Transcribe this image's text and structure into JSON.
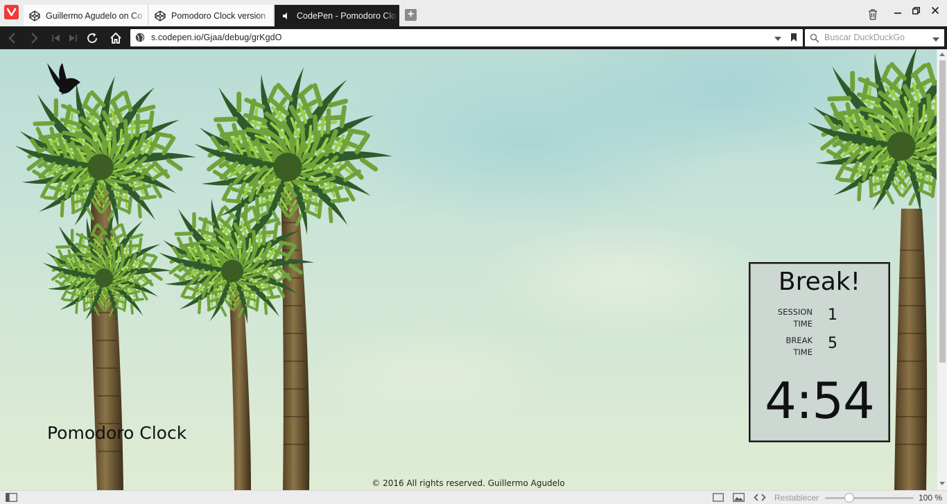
{
  "browser": {
    "tabs": [
      {
        "label": "Guillermo Agudelo on Co",
        "icon": "codepen-icon",
        "active": false
      },
      {
        "label": "Pomodoro Clock version",
        "icon": "codepen-icon",
        "active": false
      },
      {
        "label": "CodePen - Pomodoro Clo",
        "icon": "speaker-icon",
        "active": true
      }
    ],
    "address": "s.codepen.io/Gjaa/debug/grKgdO",
    "search_placeholder": "Buscar DuckDuckGo",
    "statusbar": {
      "reset_label": "Restablecer",
      "zoom": "100 %"
    }
  },
  "page": {
    "title": "Pomodoro Clock",
    "footer": "© 2016 All rights reserved. Guillermo Agudelo",
    "timer": {
      "status": "Break!",
      "session_label_1": "SESSION",
      "session_label_2": "TIME",
      "session_value": "1",
      "break_label_1": "BREAK",
      "break_label_2": "TIME",
      "break_value": "5",
      "countdown": "4:54"
    }
  },
  "colors": {
    "chrome_dark": "#1d1d1d",
    "vivaldi_red": "#ef3939",
    "sky": "#c6e2d8"
  }
}
